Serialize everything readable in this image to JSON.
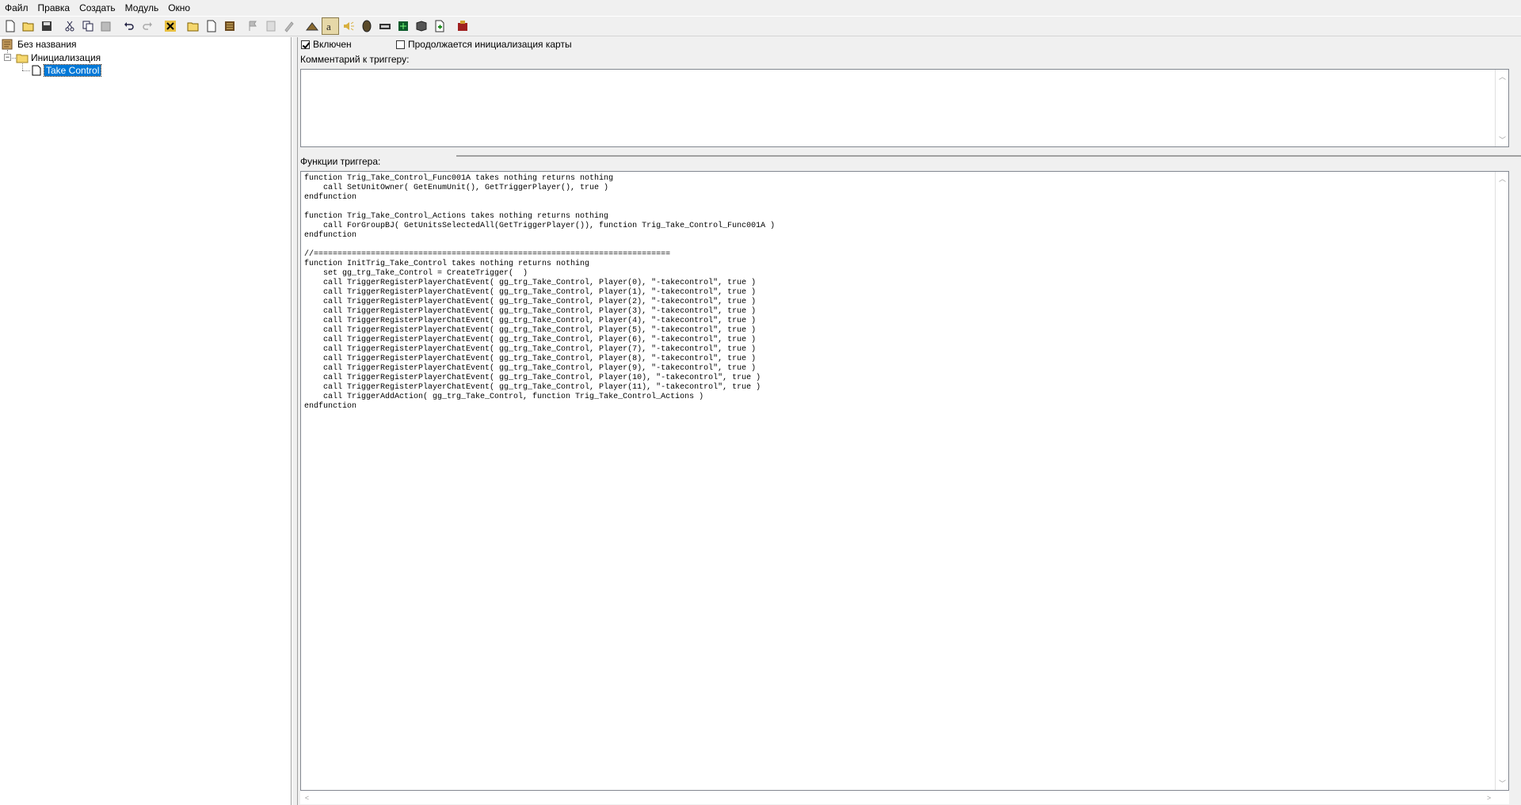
{
  "menu": [
    "Файл",
    "Правка",
    "Создать",
    "Модуль",
    "Окно"
  ],
  "toolbar": {
    "icons": [
      "new-icon",
      "open-icon",
      "save-icon",
      "cut-icon",
      "copy-icon",
      "paste-icon",
      "undo-icon",
      "redo-icon",
      "delete-icon",
      "new-category-icon",
      "new-trigger-icon",
      "new-comment-icon",
      "new-event-icon",
      "new-condition-icon",
      "new-action-icon",
      "terrain-editor-icon",
      "trigger-editor-icon",
      "sound-editor-icon",
      "object-editor-icon",
      "campaign-editor-icon",
      "ai-editor-icon",
      "object-manager-icon",
      "import-manager-icon",
      "test-map-icon"
    ]
  },
  "tree": {
    "root": "Без названия",
    "category": "Инициализация",
    "trigger": "Take Control"
  },
  "trigger": {
    "enabled_label": "Включен",
    "enabled": true,
    "init_label": "Продолжается инициализация карты",
    "init_checked": false,
    "comment_label": "Комментарий к триггеру:",
    "comment_text": "",
    "functions_label": "Функции триггера:",
    "code": "function Trig_Take_Control_Func001A takes nothing returns nothing\n    call SetUnitOwner( GetEnumUnit(), GetTriggerPlayer(), true )\nendfunction\n\nfunction Trig_Take_Control_Actions takes nothing returns nothing\n    call ForGroupBJ( GetUnitsSelectedAll(GetTriggerPlayer()), function Trig_Take_Control_Func001A )\nendfunction\n\n//===========================================================================\nfunction InitTrig_Take_Control takes nothing returns nothing\n    set gg_trg_Take_Control = CreateTrigger(  )\n    call TriggerRegisterPlayerChatEvent( gg_trg_Take_Control, Player(0), \"-takecontrol\", true )\n    call TriggerRegisterPlayerChatEvent( gg_trg_Take_Control, Player(1), \"-takecontrol\", true )\n    call TriggerRegisterPlayerChatEvent( gg_trg_Take_Control, Player(2), \"-takecontrol\", true )\n    call TriggerRegisterPlayerChatEvent( gg_trg_Take_Control, Player(3), \"-takecontrol\", true )\n    call TriggerRegisterPlayerChatEvent( gg_trg_Take_Control, Player(4), \"-takecontrol\", true )\n    call TriggerRegisterPlayerChatEvent( gg_trg_Take_Control, Player(5), \"-takecontrol\", true )\n    call TriggerRegisterPlayerChatEvent( gg_trg_Take_Control, Player(6), \"-takecontrol\", true )\n    call TriggerRegisterPlayerChatEvent( gg_trg_Take_Control, Player(7), \"-takecontrol\", true )\n    call TriggerRegisterPlayerChatEvent( gg_trg_Take_Control, Player(8), \"-takecontrol\", true )\n    call TriggerRegisterPlayerChatEvent( gg_trg_Take_Control, Player(9), \"-takecontrol\", true )\n    call TriggerRegisterPlayerChatEvent( gg_trg_Take_Control, Player(10), \"-takecontrol\", true )\n    call TriggerRegisterPlayerChatEvent( gg_trg_Take_Control, Player(11), \"-takecontrol\", true )\n    call TriggerAddAction( gg_trg_Take_Control, function Trig_Take_Control_Actions )\nendfunction"
  },
  "colors": {
    "selection": "#0078d7",
    "background": "#f0f0f0"
  }
}
